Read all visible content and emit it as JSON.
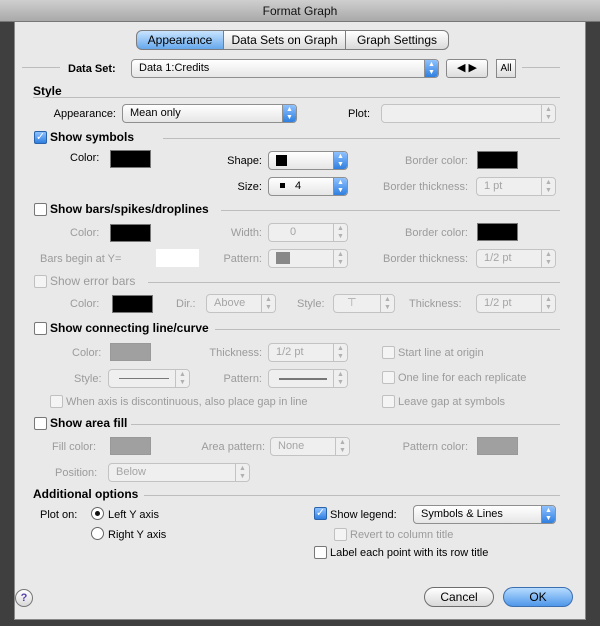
{
  "window": {
    "title": "Format Graph"
  },
  "tabs": [
    "Appearance",
    "Data Sets on Graph",
    "Graph Settings"
  ],
  "dataset": {
    "label": "Data Set:",
    "value": "Data 1:Credits",
    "all_label": "All"
  },
  "style": {
    "section": "Style",
    "appearance_label": "Appearance:",
    "appearance_value": "Mean only",
    "plot_label": "Plot:",
    "plot_value": ""
  },
  "symbols": {
    "checkbox": "Show symbols",
    "color_label": "Color:",
    "shape_label": "Shape:",
    "size_label": "Size:",
    "size_value": "4",
    "border_color_label": "Border color:",
    "border_thickness_label": "Border thickness:",
    "border_thickness_value": "1 pt"
  },
  "bars": {
    "checkbox": "Show bars/spikes/droplines",
    "color_label": "Color:",
    "width_label": "Width:",
    "width_value": "0",
    "border_color_label": "Border color:",
    "begin_label": "Bars begin at Y=",
    "pattern_label": "Pattern:",
    "border_thickness_label": "Border thickness:",
    "border_thickness_value": "1/2 pt"
  },
  "error_bars": {
    "checkbox": "Show error bars",
    "color_label": "Color:",
    "dir_label": "Dir.:",
    "dir_value": "Above",
    "style_label": "Style:",
    "style_value": "⊤",
    "thickness_label": "Thickness:",
    "thickness_value": "1/2 pt"
  },
  "line": {
    "checkbox": "Show connecting line/curve",
    "color_label": "Color:",
    "thickness_label": "Thickness:",
    "thickness_value": "1/2 pt",
    "start_origin": "Start line at origin",
    "style_label": "Style:",
    "pattern_label": "Pattern:",
    "one_line": "One line for each replicate",
    "gap_discontinuous": "When axis is discontinuous, also place gap in line",
    "leave_gap": "Leave gap at symbols"
  },
  "area": {
    "checkbox": "Show area fill",
    "fill_color_label": "Fill color:",
    "area_pattern_label": "Area pattern:",
    "area_pattern_value": "None",
    "pattern_color_label": "Pattern color:",
    "position_label": "Position:",
    "position_value": "Below"
  },
  "options": {
    "section": "Additional options",
    "plot_on_label": "Plot on:",
    "left_axis": "Left Y axis",
    "right_axis": "Right Y axis",
    "show_legend": "Show legend:",
    "legend_value": "Symbols & Lines",
    "revert": "Revert to column title",
    "label_point": "Label each point with its row title"
  },
  "buttons": {
    "help": "?",
    "cancel": "Cancel",
    "ok": "OK"
  },
  "colors": {
    "accent": "#3d8ee8",
    "selected_tab": "#7fb6f2"
  }
}
